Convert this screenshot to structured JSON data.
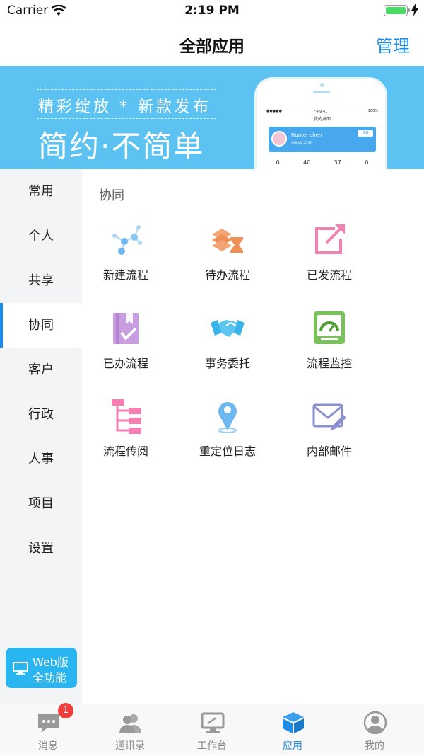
{
  "status_bar": {
    "carrier": "Carrier",
    "time": "2:19 PM"
  },
  "nav": {
    "title": "全部应用",
    "manage_label": "管理"
  },
  "banner": {
    "tagline": "精彩绽放 * 新款发布",
    "slogan": "简约·不简单",
    "phone": {
      "status_time": "上午9:41",
      "status_battery": "100%",
      "title": "我的桌面",
      "user_name": "Hunter chen",
      "user_dept": "市场总监",
      "user_date": "5月3日",
      "signin": "签到",
      "stats": [
        "0",
        "40",
        "37",
        "0"
      ]
    }
  },
  "sidebar": {
    "items": [
      {
        "label": "常用",
        "active": false
      },
      {
        "label": "个人",
        "active": false
      },
      {
        "label": "共享",
        "active": false
      },
      {
        "label": "协同",
        "active": true
      },
      {
        "label": "客户",
        "active": false
      },
      {
        "label": "行政",
        "active": false
      },
      {
        "label": "人事",
        "active": false
      },
      {
        "label": "项目",
        "active": false
      },
      {
        "label": "设置",
        "active": false
      }
    ],
    "web_button": {
      "line1": "Web版",
      "line2": "全功能"
    }
  },
  "main": {
    "section_title": "协同",
    "apps": [
      {
        "label": "新建流程",
        "icon": "network-nodes-icon"
      },
      {
        "label": "待办流程",
        "icon": "stack-hourglass-icon"
      },
      {
        "label": "已发流程",
        "icon": "share-arrow-icon"
      },
      {
        "label": "已办流程",
        "icon": "checked-book-icon"
      },
      {
        "label": "事务委托",
        "icon": "handshake-icon"
      },
      {
        "label": "流程监控",
        "icon": "gauge-monitor-icon"
      },
      {
        "label": "流程传阅",
        "icon": "flow-tree-icon"
      },
      {
        "label": "重定位日志",
        "icon": "location-pin-icon"
      },
      {
        "label": "内部邮件",
        "icon": "mail-pen-icon"
      }
    ]
  },
  "tabbar": {
    "tabs": [
      {
        "label": "消息",
        "icon": "chat-bubble-icon",
        "badge": "1"
      },
      {
        "label": "通讯录",
        "icon": "contacts-icon"
      },
      {
        "label": "工作台",
        "icon": "monitor-icon"
      },
      {
        "label": "应用",
        "icon": "cube-icon",
        "active": true
      },
      {
        "label": "我的",
        "icon": "profile-icon"
      }
    ]
  },
  "colors": {
    "accent": "#1c8ce6",
    "banner": "#5cc2f2",
    "web_button": "#29b5ef",
    "badge": "#f03d3d",
    "sidebar_bg": "#f3f4f6"
  }
}
